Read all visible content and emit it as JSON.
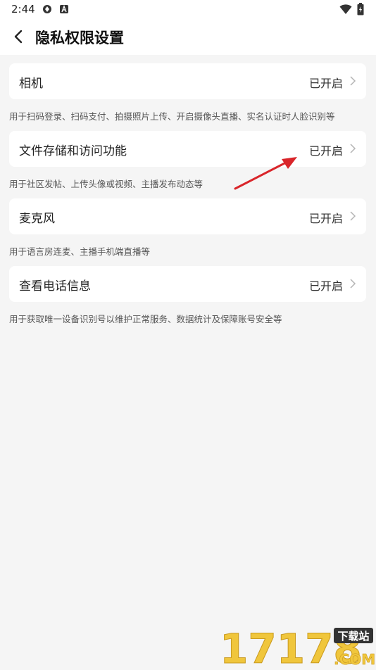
{
  "status_bar": {
    "time": "2:44",
    "icons": [
      "sync-icon",
      "app-a-icon",
      "wifi-icon",
      "battery-icon"
    ]
  },
  "header": {
    "back_icon": "chevron-left-icon",
    "title": "隐私权限设置"
  },
  "permissions": [
    {
      "title": "相机",
      "status": "已开启",
      "desc": "用于扫码登录、扫码支付、拍摄照片上传、开启摄像头直播、实名认证时人脸识别等"
    },
    {
      "title": "文件存储和访问功能",
      "status": "已开启",
      "desc": "用于社区发帖、上传头像或视频、主播发布动态等"
    },
    {
      "title": "麦克风",
      "status": "已开启",
      "desc": "用于语言房连麦、主播手机端直播等"
    },
    {
      "title": "查看电话信息",
      "status": "已开启",
      "desc": "用于获取唯一设备识别号以维护正常服务、数据统计及保障账号安全等"
    }
  ],
  "annotation": {
    "arrow_color": "#d9252a"
  },
  "watermark": {
    "brand": "17178",
    "tag": "下载站",
    "domain": ".COM"
  },
  "colors": {
    "background": "#f5f5f5",
    "card": "#ffffff",
    "watermark_gold": "#f0c63c"
  }
}
